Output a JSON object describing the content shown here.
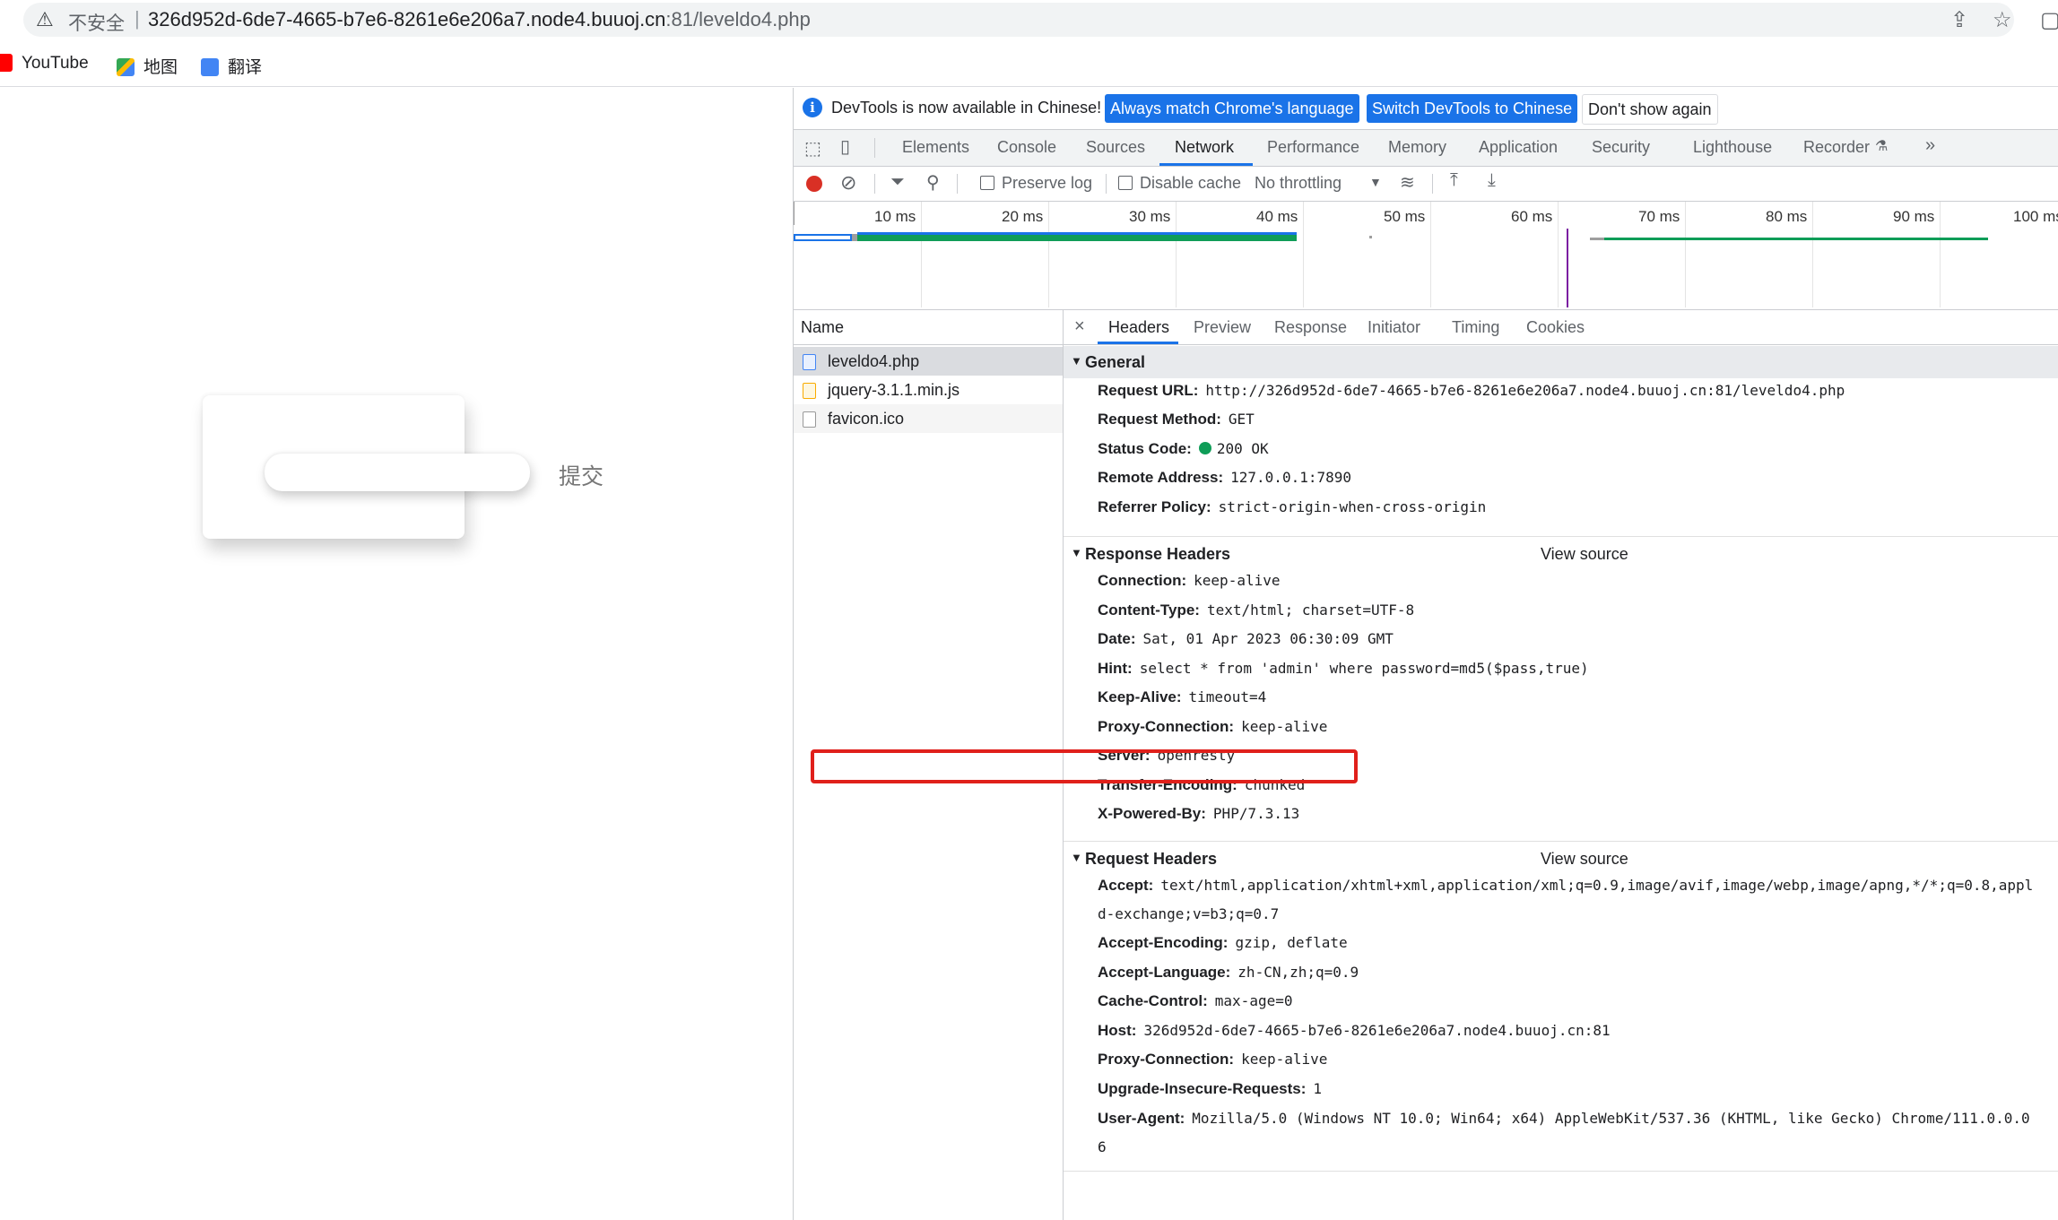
{
  "browser": {
    "security_label": "不安全",
    "url_host": "326d952d-6de7-4665-b7e6-8261e6e206a7.node4.buuoj.cn",
    "url_rest": ":81/leveldo4.php",
    "bookmarks": [
      {
        "label": "YouTube"
      },
      {
        "label": "地图"
      },
      {
        "label": "翻译"
      }
    ]
  },
  "page": {
    "submit_label": "提交",
    "password_value": ""
  },
  "devtools": {
    "info": {
      "message": "DevTools is now available in Chinese!",
      "btn_match": "Always match Chrome's language",
      "btn_switch": "Switch DevTools to Chinese",
      "btn_dismiss": "Don't show again"
    },
    "tabs": [
      "Elements",
      "Console",
      "Sources",
      "Network",
      "Performance",
      "Memory",
      "Application",
      "Security",
      "Lighthouse",
      "Recorder"
    ],
    "toolbar": {
      "preserve_log": "Preserve log",
      "disable_cache": "Disable cache",
      "throttling": "No throttling"
    },
    "timeline_labels": [
      "10 ms",
      "20 ms",
      "30 ms",
      "40 ms",
      "50 ms",
      "60 ms",
      "70 ms",
      "80 ms",
      "90 ms",
      "100 ms"
    ],
    "name_header": "Name",
    "requests": [
      {
        "name": "leveldo4.php",
        "selected": true
      },
      {
        "name": "jquery-3.1.1.min.js",
        "selected": false
      },
      {
        "name": "favicon.ico",
        "selected": false
      }
    ],
    "detail_tabs": [
      "Headers",
      "Preview",
      "Response",
      "Initiator",
      "Timing",
      "Cookies"
    ],
    "general": {
      "title": "General",
      "rows": [
        {
          "k": "Request URL:",
          "v": "http://326d952d-6de7-4665-b7e6-8261e6e206a7.node4.buuoj.cn:81/leveldo4.php"
        },
        {
          "k": "Request Method:",
          "v": "GET"
        },
        {
          "k": "Status Code:",
          "v": "200 OK"
        },
        {
          "k": "Remote Address:",
          "v": "127.0.0.1:7890"
        },
        {
          "k": "Referrer Policy:",
          "v": "strict-origin-when-cross-origin"
        }
      ]
    },
    "response_headers": {
      "title": "Response Headers",
      "view_source": "View source",
      "rows": [
        {
          "k": "Connection:",
          "v": "keep-alive"
        },
        {
          "k": "Content-Type:",
          "v": "text/html; charset=UTF-8"
        },
        {
          "k": "Date:",
          "v": "Sat, 01 Apr 2023 06:30:09 GMT"
        },
        {
          "k": "Hint:",
          "v": "select * from 'admin' where password=md5($pass,true)"
        },
        {
          "k": "Keep-Alive:",
          "v": "timeout=4"
        },
        {
          "k": "Proxy-Connection:",
          "v": "keep-alive"
        },
        {
          "k": "Server:",
          "v": "openresty"
        },
        {
          "k": "Transfer-Encoding:",
          "v": "chunked"
        },
        {
          "k": "X-Powered-By:",
          "v": "PHP/7.3.13"
        }
      ]
    },
    "request_headers": {
      "title": "Request Headers",
      "view_source": "View source",
      "accept_k": "Accept:",
      "accept_v": "text/html,application/xhtml+xml,application/xml;q=0.9,image/avif,image/webp,image/apng,*/*;q=0.8,appl",
      "accept_wrap": "d-exchange;v=b3;q=0.7",
      "rows": [
        {
          "k": "Accept-Encoding:",
          "v": "gzip, deflate"
        },
        {
          "k": "Accept-Language:",
          "v": "zh-CN,zh;q=0.9"
        },
        {
          "k": "Cache-Control:",
          "v": "max-age=0"
        },
        {
          "k": "Host:",
          "v": "326d952d-6de7-4665-b7e6-8261e6e206a7.node4.buuoj.cn:81"
        },
        {
          "k": "Proxy-Connection:",
          "v": "keep-alive"
        },
        {
          "k": "Upgrade-Insecure-Requests:",
          "v": "1"
        }
      ],
      "ua_k": "User-Agent:",
      "ua_v": "Mozilla/5.0 (Windows NT 10.0; Win64; x64) AppleWebKit/537.36 (KHTML, like Gecko) Chrome/111.0.0.0",
      "ua_wrap": "6"
    },
    "colors": {
      "accent": "#1a73e8",
      "record": "#d93025",
      "status_ok": "#0f9d58",
      "hint_box": "#e0201b"
    }
  }
}
